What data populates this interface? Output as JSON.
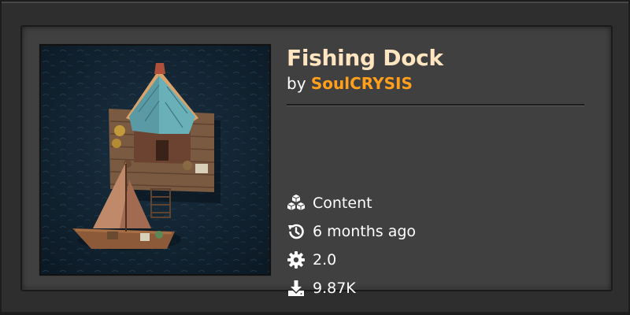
{
  "mod": {
    "title": "Fishing Dock",
    "by_prefix": "by ",
    "author": "SoulCRYSIS",
    "thumbnail_icon": "fishing-dock-thumbnail"
  },
  "stats": [
    {
      "icon": "cubes-icon",
      "text": "Content"
    },
    {
      "icon": "history-icon",
      "text": "6 months ago"
    },
    {
      "icon": "gear-icon",
      "text": "2.0"
    },
    {
      "icon": "download-icon",
      "text": "9.87K"
    }
  ],
  "colors": {
    "title": "#ffe6c0",
    "author": "#ff9f1b",
    "panel": "#414040",
    "background": "#2e2e2e",
    "water": "#0f1f2c"
  }
}
